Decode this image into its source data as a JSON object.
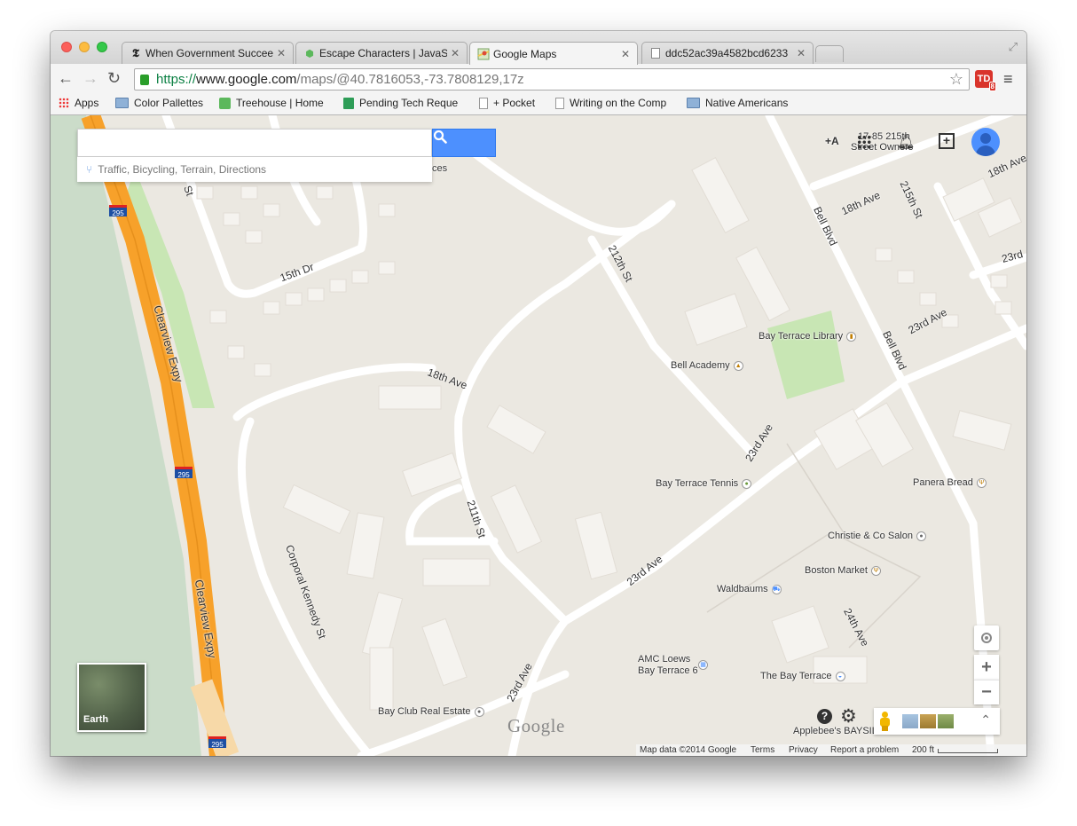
{
  "window": {
    "tabs": [
      {
        "label": "When Government Succeeds",
        "icon": "nytimes-icon",
        "active": false
      },
      {
        "label": "Escape Characters | JavaScript",
        "icon": "hexagon-icon",
        "active": false
      },
      {
        "label": "Google Maps",
        "icon": "google-maps-icon",
        "active": true
      },
      {
        "label": "ddc52ac39a4582bcd6233",
        "icon": "page-icon",
        "active": false
      }
    ]
  },
  "toolbar": {
    "url_scheme": "https://",
    "url_host": "www.google.com",
    "url_path": "/maps/@40.7816053,-73.7808129,17z",
    "extension_badge": "8"
  },
  "bookmarks": [
    {
      "label": "Apps",
      "icon": "apps-grid-icon"
    },
    {
      "label": "Color Pallettes",
      "icon": "folder-icon"
    },
    {
      "label": "Treehouse | Home",
      "icon": "treehouse-icon"
    },
    {
      "label": "Pending Tech Reque",
      "icon": "sheets-icon"
    },
    {
      "label": "+ Pocket",
      "icon": "page-icon"
    },
    {
      "label": "Writing on the Comp",
      "icon": "page-icon"
    },
    {
      "label": "Native Americans",
      "icon": "folder-icon"
    }
  ],
  "map": {
    "search_value": "",
    "suggestion": "Traffic, Bicycling, Terrain, Directions",
    "top_right_address": "17-85 215th",
    "top_right_address2": "Street Owners",
    "plus_a": "+A",
    "earth_label": "Earth",
    "logo": "Google",
    "highway_shield": "295",
    "streets": {
      "clearview1": "Clearview Expy",
      "clearview2": "Clearview Expy",
      "s15th_dr": "15th Dr",
      "s18th_ave_a": "18th Ave",
      "s18th_ave_b": "18th Ave",
      "s18th_ave_c": "18th Ave",
      "s212th": "212th St",
      "s211th": "211th St",
      "s215th": "215th St",
      "bell1": "Bell Blvd",
      "bell2": "Bell Blvd",
      "s23rd_a": "23rd Ave",
      "s23rd_b": "23rd Ave",
      "s23rd_c": "23rd Ave",
      "s23rd_d": "23rd Ave",
      "s23rd_e": "23rd",
      "s24th": "24th Ave",
      "corporal": "Corporal Kennedy St",
      "st_left": "St",
      "ces": "ces"
    },
    "places": {
      "library": "Bay Terrace Library",
      "academy": "Bell Academy",
      "tennis": "Bay Terrace Tennis",
      "panera": "Panera Bread",
      "christie": "Christie & Co Salon",
      "boston": "Boston Market",
      "waldbaums": "Waldbaums",
      "amc1": "AMC Loews",
      "amc2": "Bay Terrace 6",
      "bayterrace": "The Bay Terrace",
      "bayclub": "Bay Club Real Estate",
      "applebees": "Applebee's BAYSIL"
    },
    "footer": {
      "data": "Map data ©2014 Google",
      "terms": "Terms",
      "privacy": "Privacy",
      "report": "Report a problem",
      "scale": "200 ft"
    }
  },
  "colors": {
    "highway": "#f7a12a",
    "water": "#cbdcc9",
    "park": "#c8e6b4",
    "land": "#ebe8e1",
    "building": "#f5f3ef",
    "accent": "#4d90fe"
  }
}
